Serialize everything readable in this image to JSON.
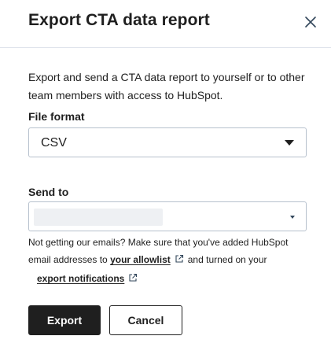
{
  "dialog": {
    "title": "Export CTA data report",
    "close_icon": "close-icon",
    "description": "Export and send a CTA data report to yourself or to other team members with access to HubSpot."
  },
  "file_format": {
    "label": "File format",
    "selected": "CSV",
    "caret_icon": "caret-down-icon"
  },
  "send_to": {
    "label": "Send to",
    "value": "",
    "caret_icon": "caret-down-icon"
  },
  "help": {
    "line1": "Not getting our emails? Make sure that you've added HubSpot",
    "line2_prefix": "email addresses to",
    "allowlist_link": "your allowlist",
    "line2_suffix": "and turned on your",
    "notifications_link": "export notifications",
    "external_icon": "external-link-icon"
  },
  "actions": {
    "export_label": "Export",
    "cancel_label": "Cancel"
  }
}
